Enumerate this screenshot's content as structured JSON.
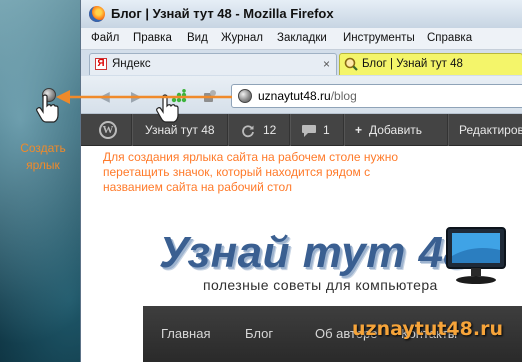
{
  "desktop": {
    "shortcut_label": "Создать ярлык",
    "accent_color": "#f08a2a"
  },
  "window": {
    "title": "Блог | Узнай тут 48 - Mozilla Firefox",
    "menu": [
      "Файл",
      "Правка",
      "Вид",
      "Журнал",
      "Закладки",
      "Инструменты",
      "Справка"
    ],
    "tabs": [
      {
        "label": "Яндекс",
        "close": "×",
        "active": false,
        "icon": "yandex-icon"
      },
      {
        "label": "Блог | Узнай тут 48",
        "close": "",
        "active": true,
        "icon": "search-icon"
      }
    ],
    "nav": {
      "back": "◀",
      "forward": "▶"
    },
    "url": {
      "host": "uznaytut48.ru",
      "path": "/blog"
    }
  },
  "adminbar": {
    "site_name": "Узнай тут 48",
    "updates_count": "12",
    "comments_count": "1",
    "add_label": "Добавить",
    "edit_label": "Редактиров"
  },
  "page": {
    "instruction": "Для создания ярлыка сайта на рабочем столе нужно перетащить значок, который находится рядом с названием сайта на рабочий стол",
    "logo_title": "Узнай тут 48",
    "logo_subtitle": "полезные советы для компьютера",
    "site_menu": [
      "Главная",
      "Блог",
      "Об авторе",
      "Контакты"
    ]
  },
  "watermark": "uznaytut48.ru",
  "colors": {
    "instruction": "#ff7a2a",
    "logo": "#3a5f91",
    "active_tab": "#f4f56a",
    "adminbar": "#444444",
    "arrow": "#f08a2a"
  }
}
